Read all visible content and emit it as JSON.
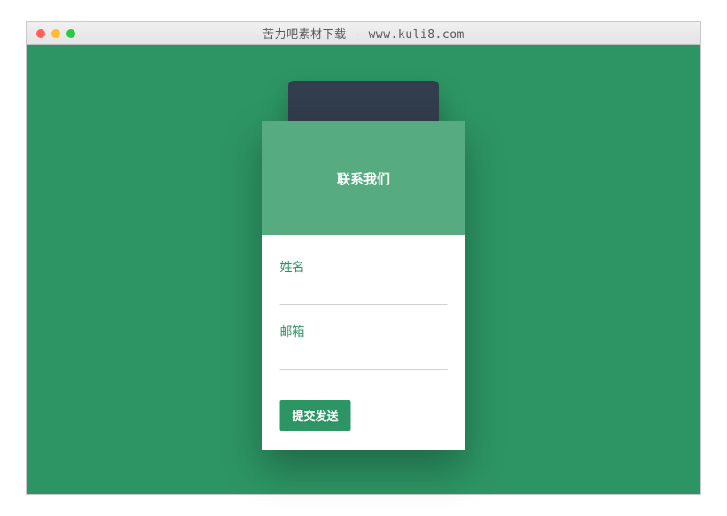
{
  "window": {
    "title": "苦力吧素材下载 - www.kuli8.com"
  },
  "form": {
    "heading": "联系我们",
    "fields": {
      "name": {
        "label": "姓名",
        "value": ""
      },
      "email": {
        "label": "邮箱",
        "value": ""
      }
    },
    "submit_label": "提交发送"
  }
}
